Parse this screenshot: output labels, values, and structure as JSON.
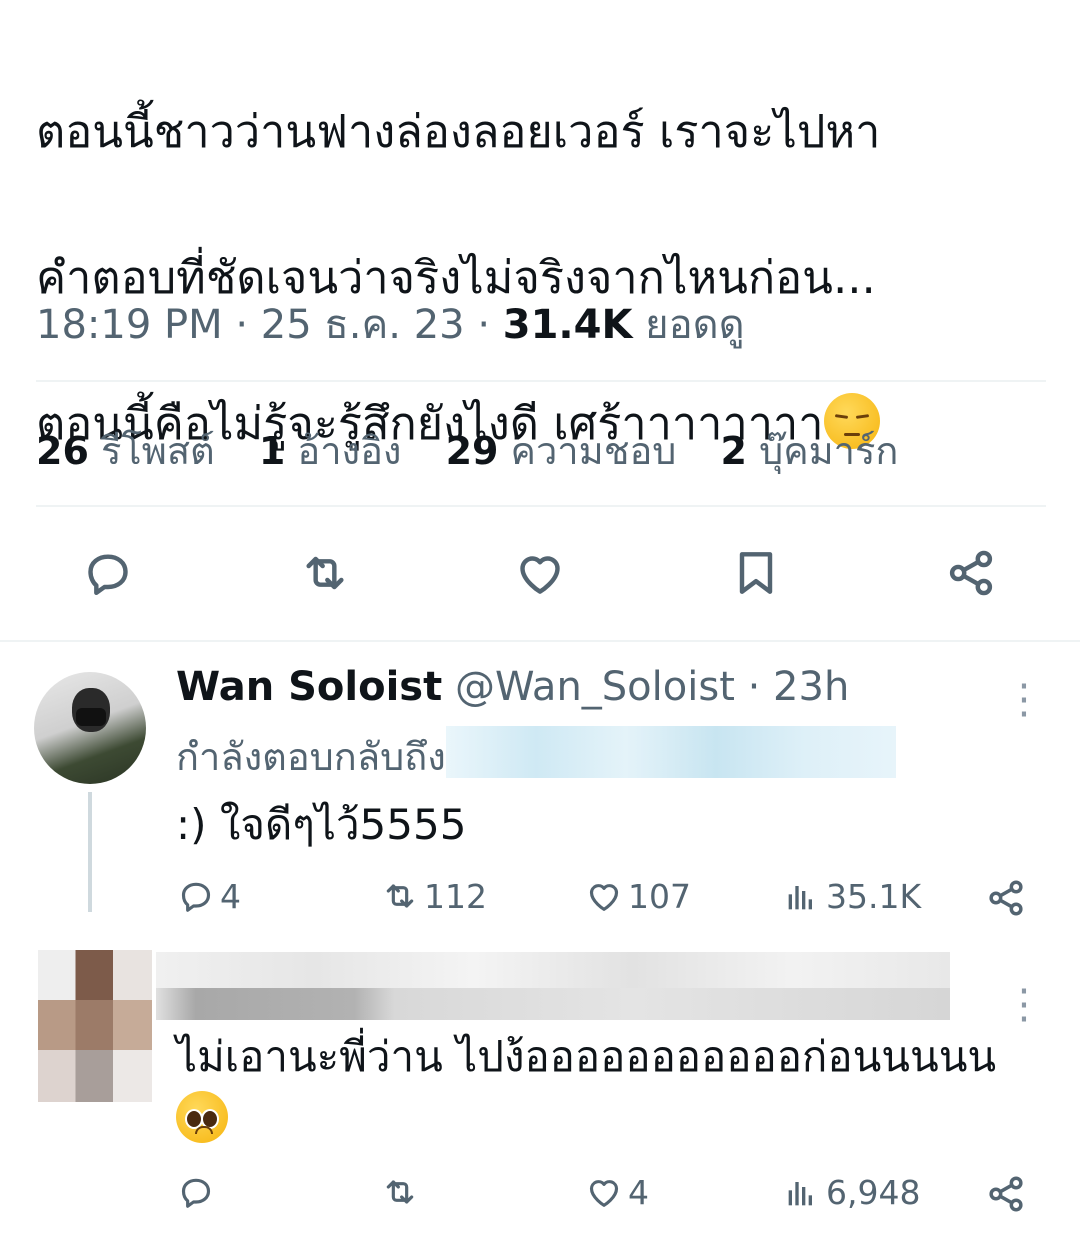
{
  "tweet": {
    "text_line1": "ตอนนี้ชาวว่านฟางล่องลอยเวอร์ เราจะไปหา",
    "text_line2": "คำตอบที่ชัดเจนว่าจริงไม่จริงจากไหนก่อน...",
    "text_line3": "ตอนนี้คือไม่รู้จะรู้สึกยังไงดี เศร้าาาาาาาา",
    "emoji": "pensive-face",
    "time": "18:19 PM",
    "sep": "·",
    "date": "25 ธ.ค. 23",
    "views": "31.4K",
    "views_label": "ยอดดู"
  },
  "stats": {
    "reposts_count": "26",
    "reposts_label": "รีโพสต์",
    "quotes_count": "1",
    "quotes_label": "อ้างอิง",
    "likes_count": "29",
    "likes_label": "ความชอบ",
    "bookmarks_count": "2",
    "bookmarks_label": "บุ๊คมาร์ก"
  },
  "actions": [
    "reply-icon",
    "repost-icon",
    "like-icon",
    "bookmark-icon",
    "share-icon"
  ],
  "reply1": {
    "display_name": "Wan Soloist",
    "handle": "@Wan_Soloist",
    "dot": "·",
    "age": "23h",
    "replying_to": "กำลังตอบกลับถึง",
    "text": ":) ใจดีๆไว้5555",
    "replies": "4",
    "reposts": "112",
    "likes": "107",
    "views": "35.1K"
  },
  "reply2": {
    "text": "ไม่เอานะพี่ว่าน ไปง้อออออออออออก่อนนนนน",
    "emoji": "pleading-face",
    "replies": "",
    "reposts": "",
    "likes": "4",
    "views": "6,948"
  },
  "colors": {
    "text": "#0f1419",
    "secondary": "#536471",
    "divider": "#eff3f4",
    "icon": "#536471"
  }
}
